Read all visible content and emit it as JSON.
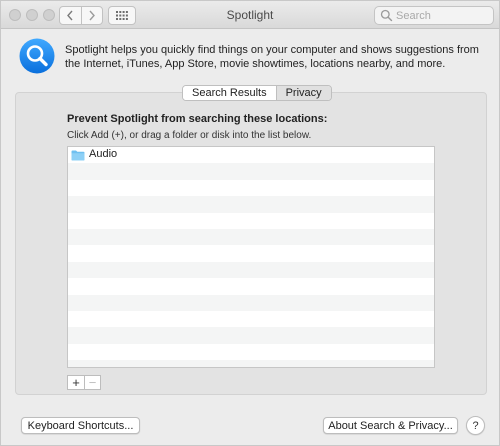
{
  "window": {
    "title": "Spotlight"
  },
  "toolbar": {
    "back_icon": "chevron-left-icon",
    "forward_icon": "chevron-right-icon",
    "show_all_icon": "grid-icon",
    "search_placeholder": "Search"
  },
  "header": {
    "icon": "spotlight-magnifier-icon",
    "description": "Spotlight helps you quickly find things on your computer and shows suggestions from the Internet, iTunes, App Store, movie showtimes, locations nearby, and more."
  },
  "tabs": [
    {
      "label": "Search Results",
      "selected": false
    },
    {
      "label": "Privacy",
      "selected": true
    }
  ],
  "privacy": {
    "heading": "Prevent Spotlight from searching these locations:",
    "instructions": "Click Add (+), or drag a folder or disk into the list below.",
    "locations": [
      {
        "name": "Audio",
        "icon": "folder-icon"
      }
    ],
    "add_label": "+",
    "remove_label": "−"
  },
  "footer": {
    "keyboard_shortcuts_label": "Keyboard Shortcuts...",
    "about_label": "About Search & Privacy...",
    "help_label": "?"
  },
  "colors": {
    "accent": "#1a8cff",
    "folder": "#6fc0f0"
  }
}
